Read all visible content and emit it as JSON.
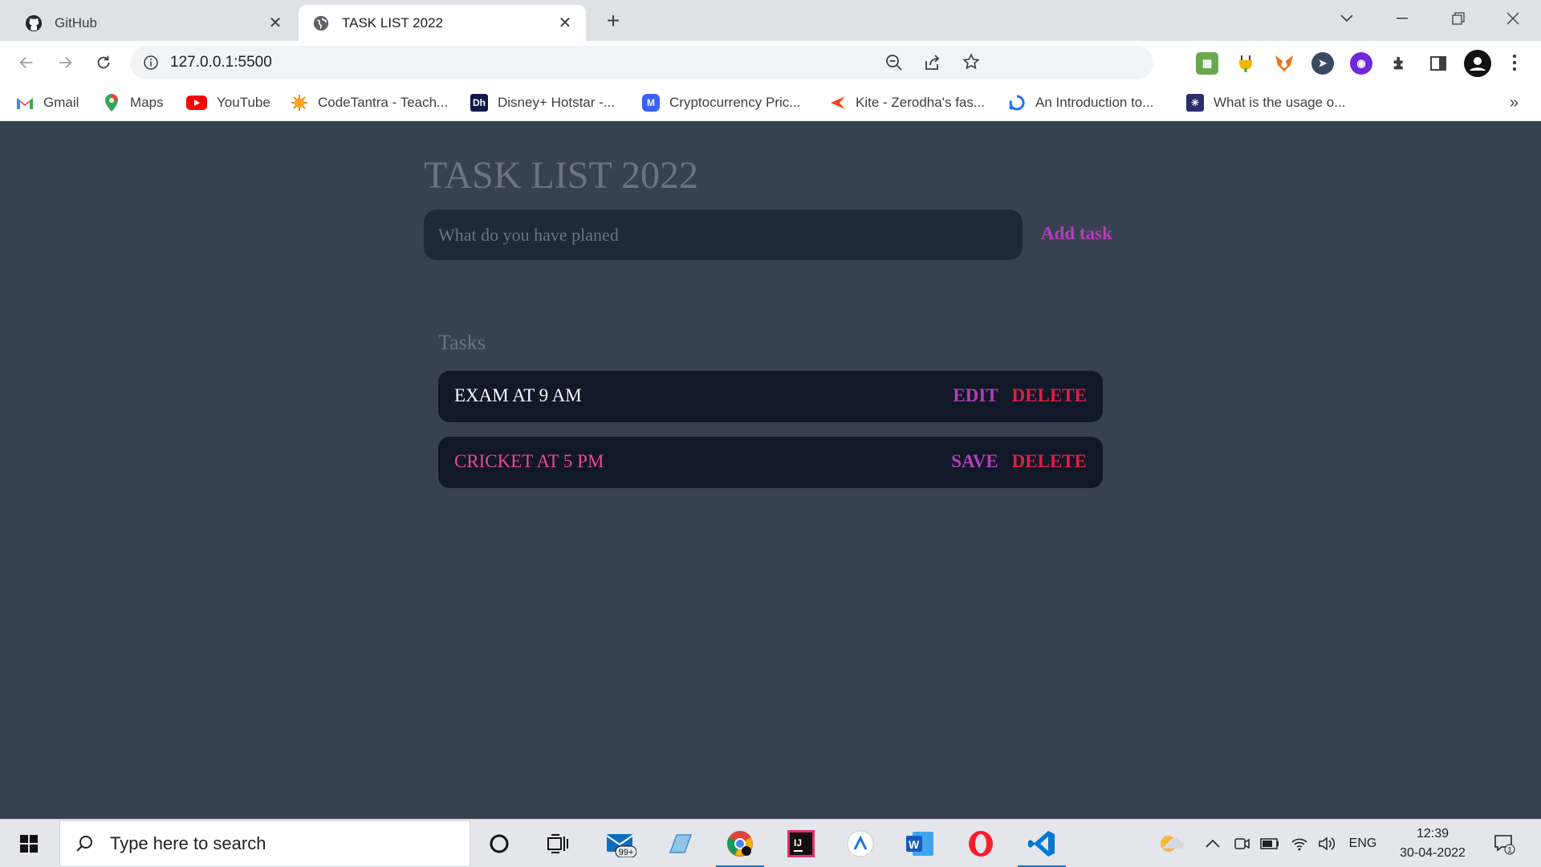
{
  "browser": {
    "tabs": [
      {
        "title": "GitHub",
        "favicon": "github-icon",
        "active": false
      },
      {
        "title": "TASK LIST 2022",
        "favicon": "globe-icon",
        "active": true
      }
    ],
    "url": "127.0.0.1:5500",
    "bookmarks": [
      {
        "label": "Gmail",
        "icon": "gmail-icon"
      },
      {
        "label": "Maps",
        "icon": "maps-icon"
      },
      {
        "label": "YouTube",
        "icon": "youtube-icon"
      },
      {
        "label": "CodeTantra - Teach...",
        "icon": "codetantra-icon"
      },
      {
        "label": "Disney+ Hotstar -...",
        "icon": "hotstar-icon"
      },
      {
        "label": "Cryptocurrency Pric...",
        "icon": "coinmarketcap-icon"
      },
      {
        "label": "Kite - Zerodha's fas...",
        "icon": "kite-icon"
      },
      {
        "label": "An Introduction to...",
        "icon": "intro-icon"
      },
      {
        "label": "What is the usage o...",
        "icon": "web-icon"
      }
    ],
    "bookmarks_overflow": "»"
  },
  "app": {
    "title": "TASK LIST 2022",
    "input_placeholder": "What do you have planed",
    "add_label": "Add task",
    "tasks_heading": "Tasks",
    "tasks": [
      {
        "text": "EXAM AT 9 AM",
        "text_color": "#ffffff",
        "action_label": "EDIT",
        "delete_label": "DELETE"
      },
      {
        "text": "CRICKET AT 5 PM",
        "text_color": "#ec4899",
        "action_label": "SAVE",
        "delete_label": "DELETE"
      }
    ],
    "colors": {
      "background": "#374151",
      "input_bg": "#1f2937",
      "task_bg": "#111827",
      "accent_purple": "#b23fba",
      "accent_red": "#e11d48"
    }
  },
  "taskbar": {
    "search_placeholder": "Type here to search",
    "mail_badge": "99+",
    "language": "ENG",
    "time": "12:39",
    "date": "30-04-2022",
    "notification_count": "1"
  }
}
